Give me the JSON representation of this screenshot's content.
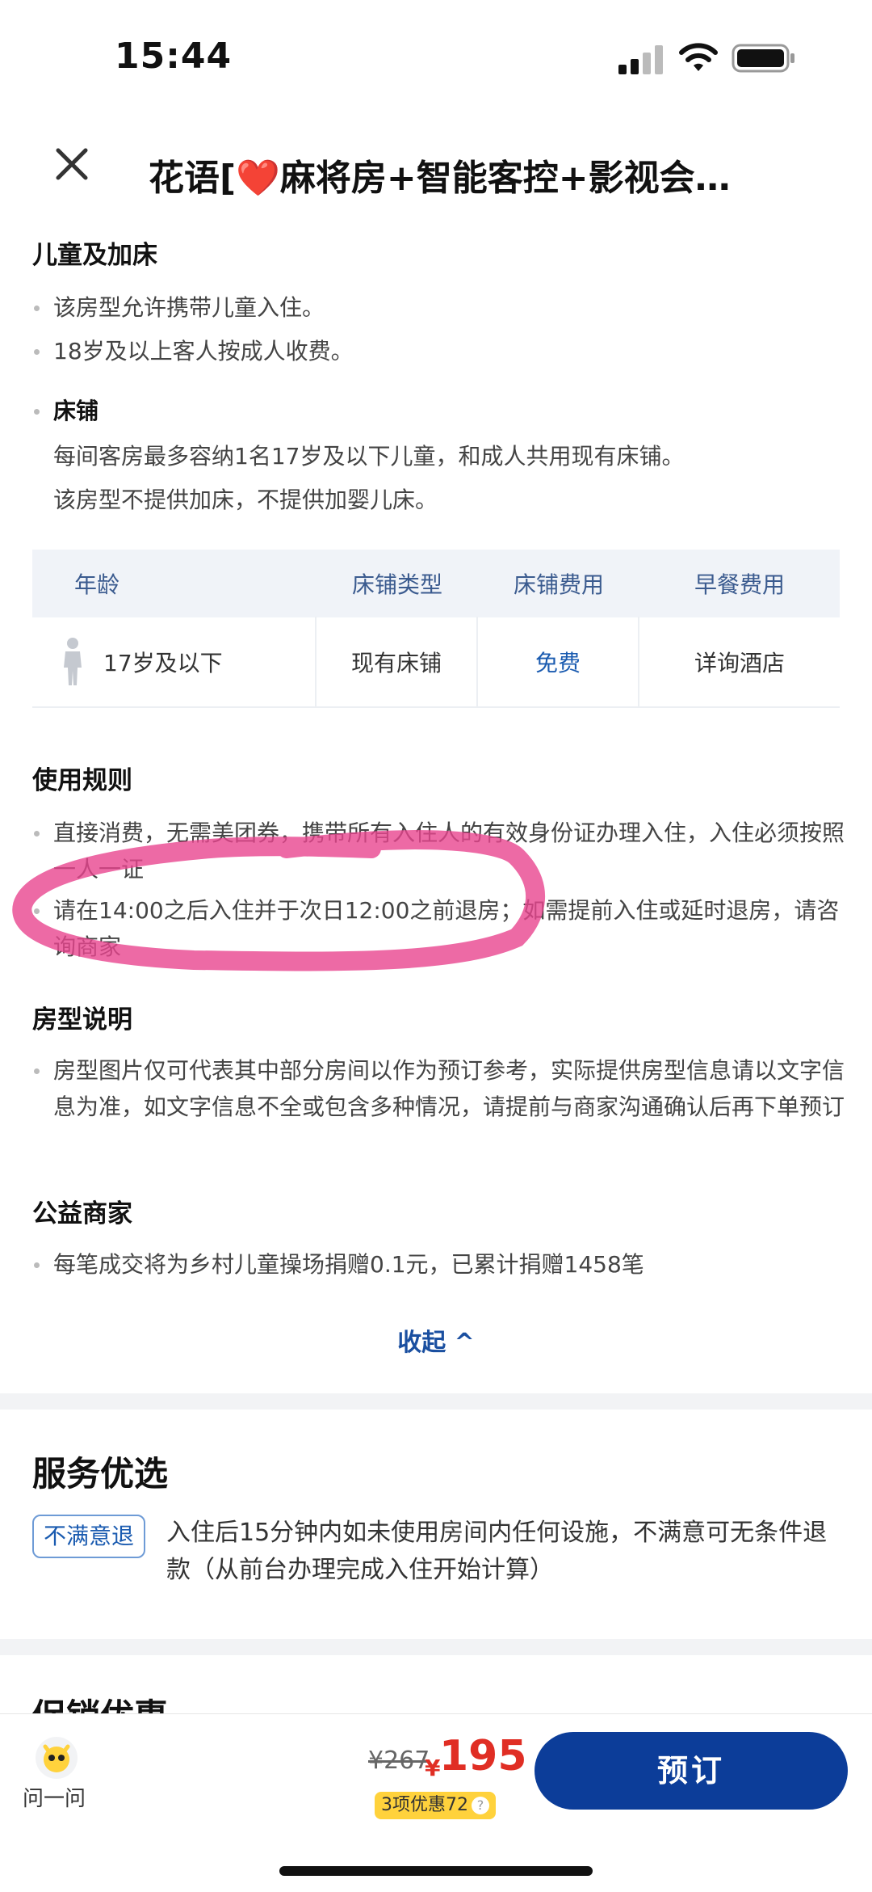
{
  "status": {
    "time": "15:44"
  },
  "header": {
    "title": "花语[❤️麻将房+智能客控+影视会…"
  },
  "children": {
    "title": "儿童及加床",
    "bullets": [
      "该房型允许携带儿童入住。",
      "18岁及以上客人按成人收费。"
    ],
    "bed_title": "床铺",
    "bed_lines": [
      "每间客房最多容纳1名17岁及以下儿童，和成人共用现有床铺。",
      "该房型不提供加床，不提供加婴儿床。"
    ]
  },
  "table": {
    "headers": [
      "年龄",
      "床铺类型",
      "床铺费用",
      "早餐费用"
    ],
    "row": [
      "17岁及以下",
      "现有床铺",
      "免费",
      "详询酒店"
    ]
  },
  "rules": {
    "title": "使用规则",
    "items": [
      "直接消费，无需美团券，携带所有入住人的有效身份证办理入住，入住必须按照一人一证",
      "请在14:00之后入住并于次日12:00之前退房；如需提前入住或延时退房，请咨询商家"
    ]
  },
  "room_desc": {
    "title": "房型说明",
    "items": [
      "房型图片仅可代表其中部分房间以作为预订参考，实际提供房型信息请以文字信息为准，如文字信息不全或包含多种情况，请提前与商家沟通确认后再下单预订"
    ]
  },
  "charity": {
    "title": "公益商家",
    "items": [
      "每笔成交将为乡村儿童操场捐赠0.1元，已累计捐赠1458笔"
    ]
  },
  "collapse_label": "收起 ^",
  "service": {
    "title": "服务优选",
    "tag": "不满意退",
    "text": "入住后15分钟内如未使用房间内任何设施，不满意可无条件退款（从前台办理完成入住开始计算）"
  },
  "promo_title": "促销优惠",
  "bottom": {
    "ask_label": "问一问",
    "old_price": "¥267",
    "currency": "¥",
    "price": "195",
    "discount": "3项优惠72",
    "discount_q": "?",
    "book_label": "预订"
  },
  "colors": {
    "accent": "#0c3d99",
    "price": "#e02e24",
    "highlight": "#e8458f"
  }
}
